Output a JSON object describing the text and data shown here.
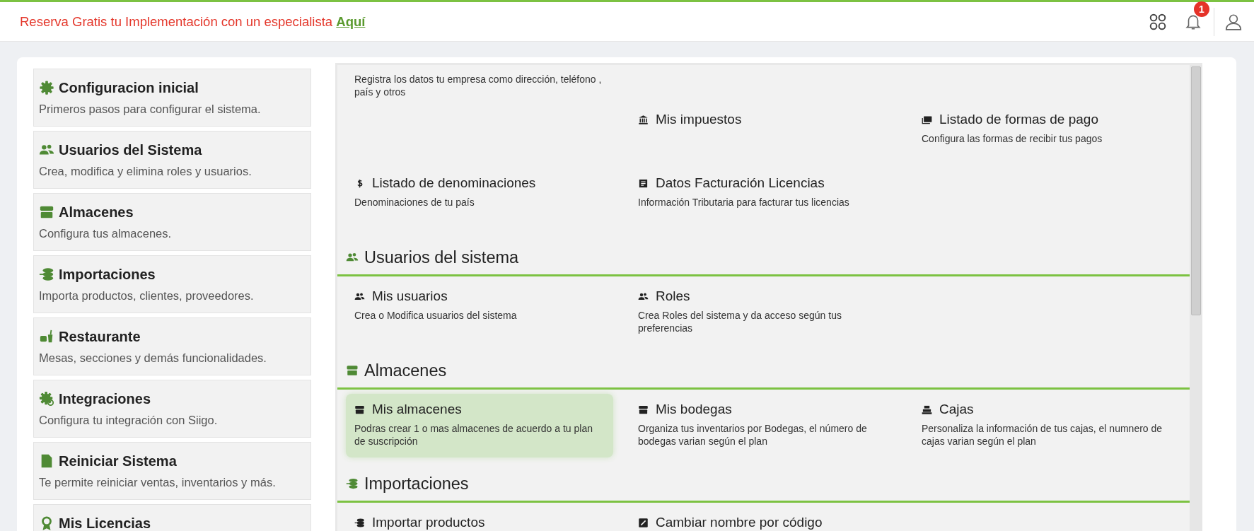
{
  "top_bar": {
    "promo": {
      "text": "Reserva Gratis tu Implementación con un especialista",
      "link": "Aquí"
    },
    "notifications": {
      "count": "1"
    }
  },
  "sidebar": {
    "items": [
      {
        "title": "Configuracion inicial",
        "description": "Primeros pasos para configurar el sistema."
      },
      {
        "title": "Usuarios del Sistema",
        "description": "Crea, modifica y elimina roles y usuarios."
      },
      {
        "title": "Almacenes",
        "description": "Configura tus almacenes."
      },
      {
        "title": "Importaciones",
        "description": "Importa productos, clientes, proveedores."
      },
      {
        "title": "Restaurante",
        "description": "Mesas, secciones y demás funcionalidades."
      },
      {
        "title": "Integraciones",
        "description": "Configura tu integración con Siigo."
      },
      {
        "title": "Reiniciar Sistema",
        "description": "Te permite reiniciar ventas, inventarios y más."
      },
      {
        "title": "Mis Licencias"
      }
    ]
  },
  "sections": [
    {
      "rows": [
        [
          {
            "description": "Registra los datos tu empresa como dirección, teléfono , país y otros",
            "selected": false
          },
          null,
          null
        ],
        [
          null,
          {
            "title": "Mis impuestos",
            "selected": false
          },
          {
            "title": "Listado de formas de pago",
            "description": "Configura las formas de recibir tus pagos",
            "selected": false
          }
        ],
        [
          {
            "title": "Listado de denominaciones",
            "description": "Denominaciones de tu país",
            "selected": false
          },
          {
            "title": "Datos Facturación Licencias",
            "description": "Información Tributaria para facturar tus licencias",
            "selected": false
          },
          null
        ]
      ]
    },
    {
      "heading": "Usuarios del sistema",
      "rows": [
        [
          {
            "title": "Mis usuarios",
            "description": "Crea o Modifica usuarios del sistema",
            "selected": false
          },
          {
            "title": "Roles",
            "description": "Crea Roles del sistema y da acceso según tus preferencias",
            "selected": false
          },
          null
        ]
      ]
    },
    {
      "heading": "Almacenes",
      "rows": [
        [
          {
            "title": "Mis almacenes",
            "description": "Podras crear 1 o mas almacenes de acuerdo a tu plan de suscripción",
            "selected": true
          },
          {
            "title": "Mis bodegas",
            "description": "Organiza tus inventarios por Bodegas, el número de bodegas varian según el plan",
            "selected": false
          },
          {
            "title": "Cajas",
            "description": "Personaliza la información de tus cajas, el numnero de cajas varian según el plan",
            "selected": false
          }
        ]
      ]
    },
    {
      "heading": "Importaciones",
      "rows": [
        [
          {
            "title": "Importar productos",
            "selected": false
          },
          {
            "title": "Cambiar nombre por código",
            "selected": false
          },
          null
        ]
      ]
    }
  ]
}
